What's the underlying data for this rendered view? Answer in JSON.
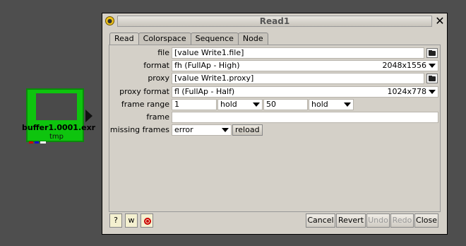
{
  "node": {
    "name": "buffer1.0001.exr",
    "sub": "tmp",
    "mark_colors": [
      "#cc0000",
      "#1111cc",
      "#ffffff"
    ]
  },
  "dialog": {
    "title": "Read1",
    "close_glyph": "✕",
    "tabs": [
      "Read",
      "Colorspace",
      "Sequence",
      "Node"
    ],
    "fields": {
      "file_label": "file",
      "file_value": "[value Write1.file]",
      "format_label": "format",
      "format_value": "fh  (FullAp - High)",
      "format_size": "2048x1556",
      "proxy_label": "proxy",
      "proxy_value": "[value Write1.proxy]",
      "proxy_format_label": "proxy format",
      "proxy_format_value": "fl  (FullAp - Half)",
      "proxy_format_size": "1024x778",
      "frame_range_label": "frame range",
      "frame_start": "1",
      "frame_start_mode": "hold",
      "frame_end": "50",
      "frame_end_mode": "hold",
      "frame_label": "frame",
      "frame_value": "",
      "missing_frames_label": "missing frames",
      "missing_frames_value": "error",
      "reload_label": "reload"
    },
    "bottom": {
      "help": "?",
      "w": "w",
      "cancel": "Cancel",
      "revert": "Revert",
      "undo": "Undo",
      "redo": "Redo",
      "close": "Close"
    }
  }
}
